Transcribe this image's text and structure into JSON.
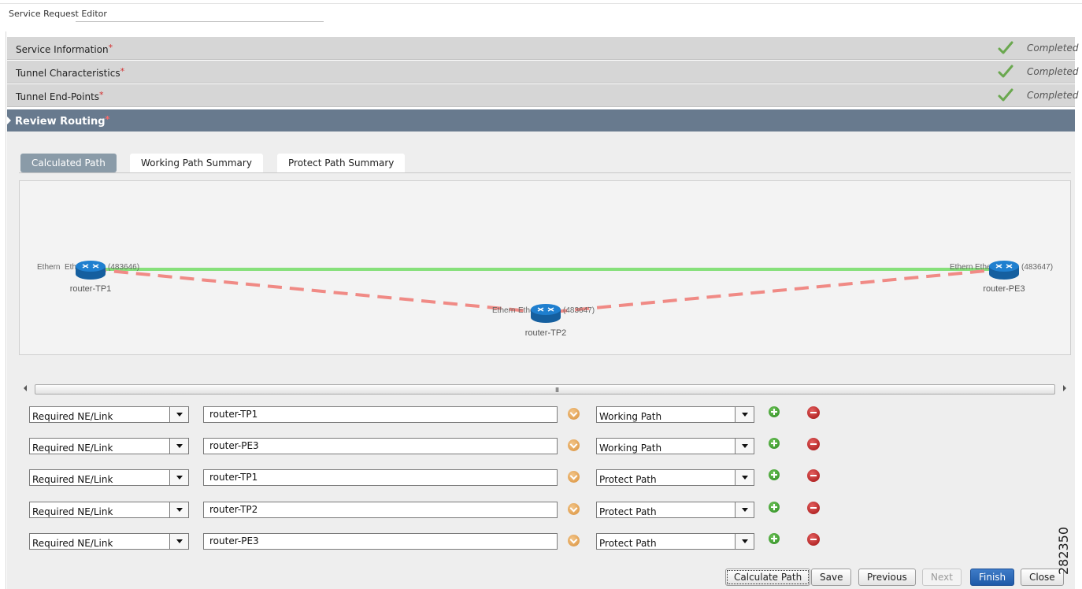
{
  "app_title": "Service Request Editor",
  "sections": [
    {
      "label": "Service Information",
      "status": "Completed"
    },
    {
      "label": "Tunnel Characteristics",
      "status": "Completed"
    },
    {
      "label": "Tunnel End-Points",
      "status": "Completed"
    }
  ],
  "active_section": {
    "label": "Review Routing"
  },
  "required_mark": "*",
  "tabs": [
    "Calculated Path",
    "Working Path Summary",
    "Protect Path Summary"
  ],
  "topology": {
    "nodes": [
      {
        "name": "router-TP1",
        "left_label": "Ethern",
        "right_label": "(483646)",
        "overlap_label": "Ethern"
      },
      {
        "name": "router-TP2",
        "left_label": "Ethern",
        "right_label": "(483647)",
        "overlap_label": "Ethern"
      },
      {
        "name": "router-PE3",
        "left_label": "Ethern",
        "right_label": "(483647)",
        "overlap_label": "Ethern"
      }
    ],
    "colors": {
      "working_path": "#86e07a",
      "protect_path": "#f08a85",
      "router": "#1f7fcf"
    }
  },
  "scrollbar_grip": "III",
  "constraints": [
    {
      "type": "Required NE/Link",
      "value": "router-TP1",
      "path": "Working Path"
    },
    {
      "type": "Required NE/Link",
      "value": "router-PE3",
      "path": "Working Path"
    },
    {
      "type": "Required NE/Link",
      "value": "router-TP1",
      "path": "Protect Path"
    },
    {
      "type": "Required NE/Link",
      "value": "router-TP2",
      "path": "Protect Path"
    },
    {
      "type": "Required NE/Link",
      "value": "router-PE3",
      "path": "Protect Path"
    }
  ],
  "footer_buttons": {
    "calculate": "Calculate Path",
    "save": "Save",
    "previous": "Previous",
    "next": "Next",
    "finish": "Finish",
    "close": "Close"
  },
  "watermark": "282350"
}
